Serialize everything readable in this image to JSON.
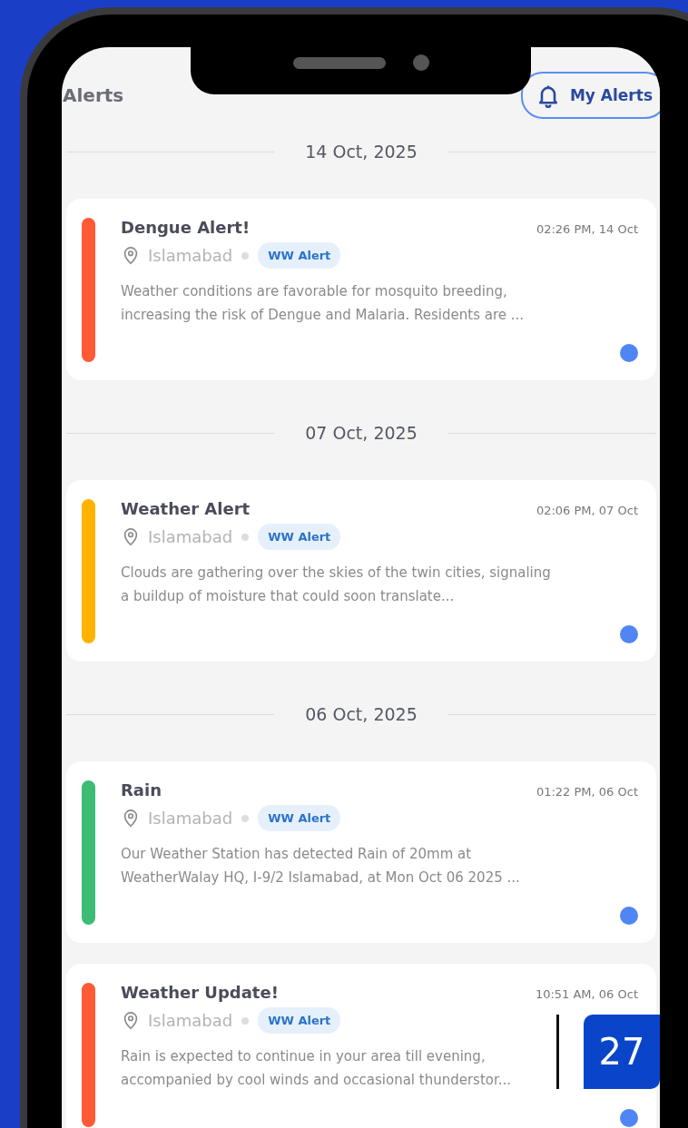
{
  "header": {
    "title": "Alerts",
    "my_alerts_button": "My Alerts"
  },
  "groups": [
    {
      "date": "14 Oct, 2025",
      "alerts": [
        {
          "title": "Dengue Alert!",
          "time": "02:26 PM, 14 Oct",
          "location": "Islamabad",
          "tag": "WW Alert",
          "message": "Weather conditions are favorable for mosquito breeding, increasing the risk of Dengue and Malaria. Residents are ...",
          "color": "#ff5a36",
          "unread": true
        }
      ]
    },
    {
      "date": "07 Oct, 2025",
      "alerts": [
        {
          "title": "Weather Alert",
          "time": "02:06 PM, 07 Oct",
          "location": "Islamabad",
          "tag": "WW Alert",
          "message": "Clouds are gathering over the skies of the twin cities, signaling a buildup of moisture that could soon translate...",
          "color": "#ffb300",
          "unread": true
        }
      ]
    },
    {
      "date": "06 Oct, 2025",
      "alerts": [
        {
          "title": "Rain",
          "time": "01:22 PM, 06 Oct",
          "location": "Islamabad",
          "tag": "WW Alert",
          "message": "Our Weather Station has detected Rain of 20mm at WeatherWalay HQ, I-9/2 Islamabad,  at Mon Oct 06 2025 ...",
          "color": "#3dbd74",
          "unread": true
        },
        {
          "title": "Weather Update!",
          "time": "10:51 AM, 06 Oct",
          "location": "Islamabad",
          "tag": "WW Alert",
          "message": "Rain is expected to continue in your area till evening, accompanied by cool winds and occasional thunderstor...",
          "color": "#ff5a36",
          "unread": true
        }
      ]
    }
  ],
  "page_badge": "27"
}
